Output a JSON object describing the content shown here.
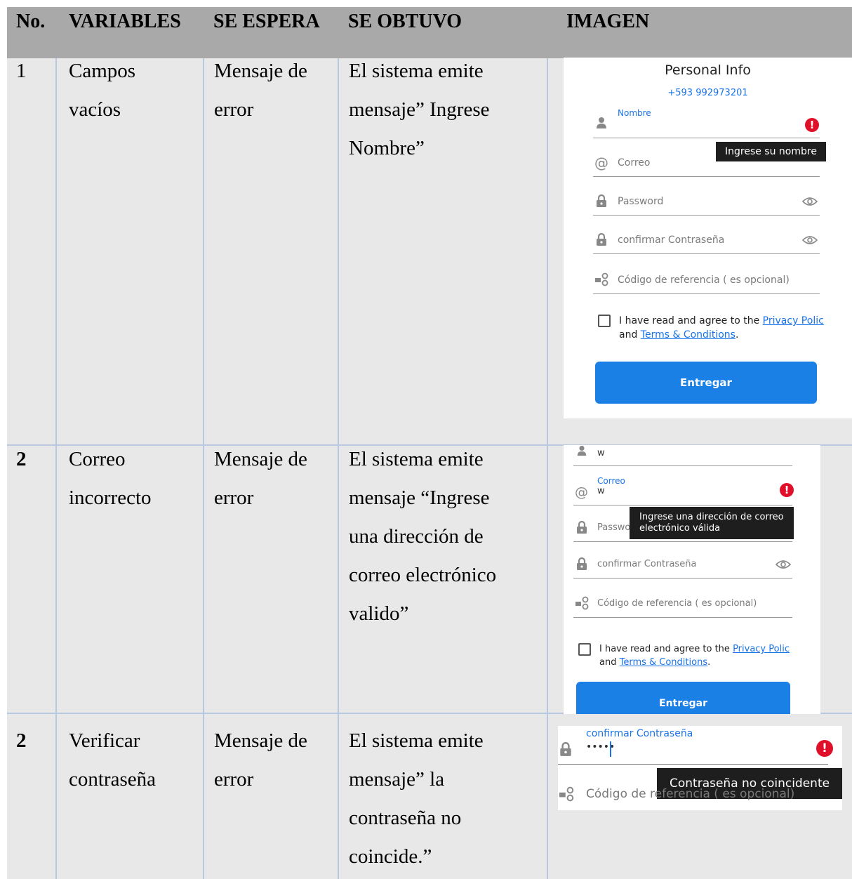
{
  "headers": {
    "no": "No.",
    "variables": "VARIABLES",
    "se_espera": "SE ESPERA",
    "se_obtuvo": "SE OBTUVO",
    "imagen": "IMAGEN"
  },
  "rows": [
    {
      "no": "1",
      "variable": [
        "Campos",
        "vacíos"
      ],
      "expected": [
        "Mensaje de",
        "error"
      ],
      "obtained": [
        "El sistema emite",
        "mensaje” Ingrese",
        "Nombre”"
      ]
    },
    {
      "no": "2",
      "variable": [
        "Correo",
        "incorrecto"
      ],
      "expected": [
        "Mensaje de",
        "error"
      ],
      "obtained": [
        "El sistema emite",
        "mensaje “Ingrese",
        "una dirección de",
        "correo electrónico",
        "valido”"
      ]
    },
    {
      "no": "2",
      "variable": [
        "Verificar",
        "contraseña"
      ],
      "expected": [
        "Mensaje de",
        "error"
      ],
      "obtained": [
        "El sistema emite",
        "mensaje” la",
        "contraseña no",
        "coincide.”"
      ]
    }
  ],
  "screen1": {
    "title": "Personal Info",
    "phone": "+593 992973201",
    "name_label": "Nombre",
    "name_error": "Ingrese su nombre",
    "email_placeholder": "Correo",
    "password_placeholder": "Password",
    "confirm_placeholder": "confirmar Contraseña",
    "referral_placeholder": "Código de referencia ( es opcional)",
    "agree_text": "I have read and agree to the ",
    "privacy_link": "Privacy Polic",
    "and_text": "and ",
    "terms_link": "Terms & Conditions",
    "period": ".",
    "submit": "Entregar"
  },
  "screen2": {
    "name_value": "w",
    "email_label": "Correo",
    "email_value": "w",
    "email_error_line1": "Ingrese una dirección de correo",
    "email_error_line2": "electrónico válida",
    "password_placeholder": "Passwo",
    "confirm_placeholder": "confirmar Contraseña",
    "referral_placeholder": "Código de referencia ( es opcional)",
    "agree_text": "I have read and agree to the ",
    "privacy_link": "Privacy Polic",
    "and_text": "and ",
    "terms_link": "Terms & Conditions",
    "period": ".",
    "submit": "Entregar"
  },
  "screen3": {
    "confirm_label": "confirmar Contraseña",
    "confirm_value": "•••••",
    "error": "Contraseña no coincidente",
    "referral_placeholder": "Código de referencia ( es opcional)"
  },
  "colors": {
    "header_bg": "#a9a9a9",
    "row_bg": "#e8e8e8",
    "grid_line": "#b8c8e0",
    "accent": "#1a80e6",
    "error": "#e0102a"
  }
}
